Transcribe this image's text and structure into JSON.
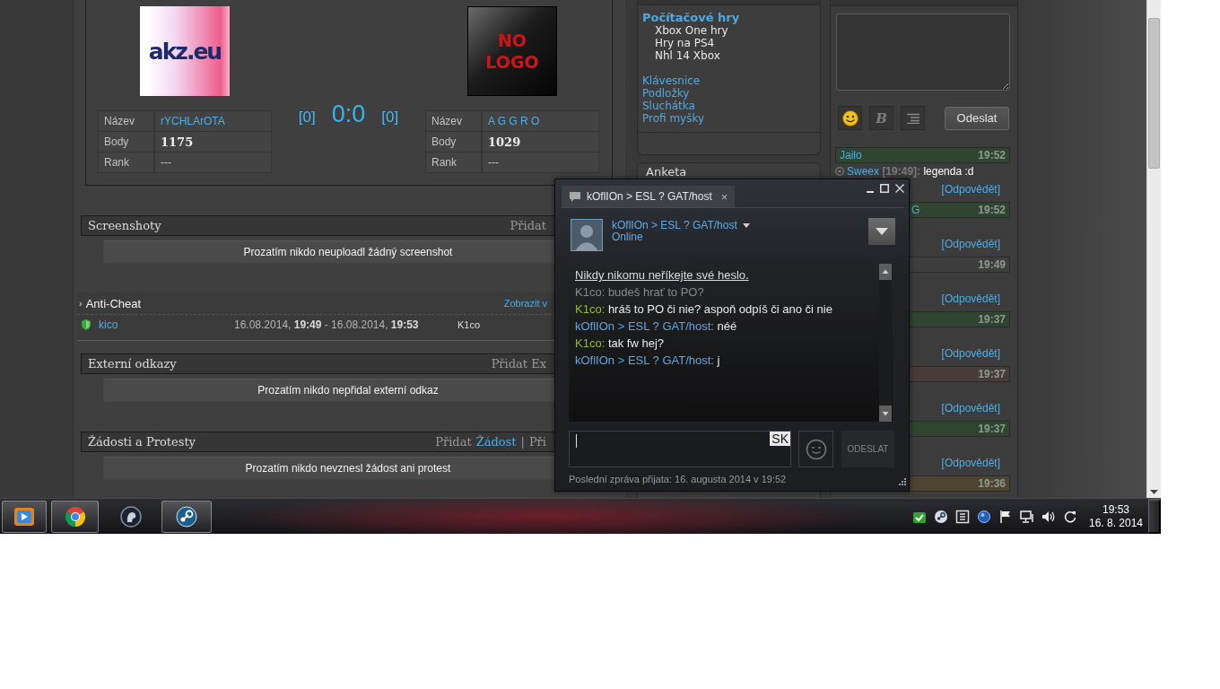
{
  "main": {
    "match": {
      "teams": [
        {
          "logo": {
            "kind": "text_logo",
            "text": "akz.eu"
          },
          "rows": [
            {
              "label": "Název",
              "value": "rYCHLArOTA",
              "kind": "link"
            },
            {
              "label": "Body",
              "value": "1175",
              "kind": "bold"
            },
            {
              "label": "Rank",
              "value": "---",
              "kind": "plain"
            }
          ]
        },
        {
          "logo": {
            "kind": "no_logo",
            "text": "NO LOGO"
          },
          "rows": [
            {
              "label": "Název",
              "value": "A G G R O",
              "kind": "link"
            },
            {
              "label": "Body",
              "value": "1029",
              "kind": "bold"
            },
            {
              "label": "Rank",
              "value": "---",
              "kind": "plain"
            }
          ]
        }
      ],
      "left_maps": "[0]",
      "score": "0:0",
      "right_maps": "[0]"
    },
    "sections": [
      {
        "kind": "panel",
        "title": "Screenshoty",
        "actions": [
          {
            "text": "Přidat",
            "link": false
          }
        ],
        "empty_text": "Prozatím nikdo neuploadl žádný screenshot"
      },
      {
        "kind": "list",
        "marker": "›",
        "title": "Anti-Cheat",
        "actions": [
          {
            "text": "Zobrazit v",
            "link": true
          }
        ],
        "rows": [
          {
            "player": "kico",
            "period": "16.08.2014, **19:49** - 16.08.2014, **19:53**",
            "account": "K1co"
          }
        ]
      },
      {
        "kind": "panel",
        "title": "Externí odkazy",
        "actions": [
          {
            "text": "Přidat Ex",
            "link": false
          }
        ],
        "empty_text": "Prozatím nikdo nepřidal externí odkaz"
      },
      {
        "kind": "panel",
        "title": "Žádosti a Protesty",
        "actions": [
          {
            "text": "Přidat",
            "link": false
          },
          {
            "text": "Žádost",
            "link": true
          },
          {
            "text": "|",
            "link": false
          },
          {
            "text": "Při",
            "link": false
          }
        ],
        "empty_text": "Prozatím nikdo nevznesl žádost ani protest"
      }
    ]
  },
  "sidebar": {
    "items": [
      {
        "label": "Počítačové hry",
        "selected": true,
        "children": [
          {
            "label": "Xbox One hry"
          },
          {
            "label": "Hry na PS4"
          },
          {
            "label": "Nhl 14 Xbox"
          }
        ]
      },
      {
        "label": "Klávesnice",
        "selected": false
      },
      {
        "label": "Podložky",
        "selected": false
      },
      {
        "label": "Sluchátka",
        "selected": false
      },
      {
        "label": "Profi myšky",
        "selected": false
      }
    ],
    "poll": {
      "title": "Anketa"
    }
  },
  "shoutbox": {
    "format_button": "B",
    "send_button": "Odeslat",
    "posts": [
      {
        "kind": "named",
        "name": "Jailo",
        "time": "19:52",
        "color": "#2f4530",
        "message": {
          "author": "Sweex",
          "time": "[19:49]:",
          "text": "legenda :d"
        },
        "reply": "[Odpovědět]"
      },
      {
        "kind": "covered",
        "name": "G",
        "time": "19:52",
        "color": "#2f4530",
        "reply": "[Odpovědět]"
      },
      {
        "kind": "covered",
        "time": "19:49",
        "color": "#3e3e3e",
        "reply": "[Odpovědět]"
      },
      {
        "kind": "covered",
        "time": "19:37",
        "color": "#2f4530",
        "reply": "[Odpovědět]"
      },
      {
        "kind": "covered",
        "time": "19:37",
        "color": "#4a3b3b",
        "reply": "[Odpovědět]"
      },
      {
        "kind": "covered",
        "time": "19:37",
        "color": "#2f4530",
        "reply": "[Odpovědět]"
      },
      {
        "kind": "covered",
        "time": "19:36",
        "color": "#4f4332"
      }
    ]
  },
  "chat_window": {
    "tab": {
      "title": "kOflIOn > ESL ? GAT/host",
      "close": "×"
    },
    "friend": {
      "name": "kOflIOn > ESL ? GAT/host",
      "status": "Online"
    },
    "messages": [
      {
        "kind": "notice",
        "text": "Nikdy nikomu neříkejte své heslo."
      },
      {
        "kind": "message",
        "sender": "K1co:",
        "text": "budeš hrať to PO?",
        "dimmed": true
      },
      {
        "kind": "message",
        "sender": "K1co:",
        "text": "hráš to PO či nie? aspoň odpíš či ano či nie",
        "color": "#8fba3a",
        "dimmed": false
      },
      {
        "kind": "message",
        "sender": "kOflIOn > ESL ? GAT/host:",
        "text": "néé",
        "color": "#5fa6e2",
        "dimmed": false
      },
      {
        "kind": "message",
        "sender": "K1co:",
        "text": "tak fw hej?",
        "color": "#8fba3a",
        "dimmed": false
      },
      {
        "kind": "message",
        "sender": "kOflIOn > ESL ? GAT/host:",
        "text": "j",
        "color": "#5fa6e2",
        "dimmed": false
      }
    ],
    "input_language": "SK",
    "send_button": {
      "label": "ODESLAT",
      "disabled": true
    },
    "footer": "Poslední zpráva přijata: 16. augusta 2014 v 19:52"
  },
  "taskbar": {
    "apps": [
      {
        "kind": "media",
        "open": true
      },
      {
        "kind": "browser",
        "open": true
      },
      {
        "kind": "voice",
        "open": false
      },
      {
        "kind": "game_client",
        "open": true
      }
    ],
    "clock": {
      "time": "19:53",
      "date": "16. 8. 2014"
    }
  }
}
